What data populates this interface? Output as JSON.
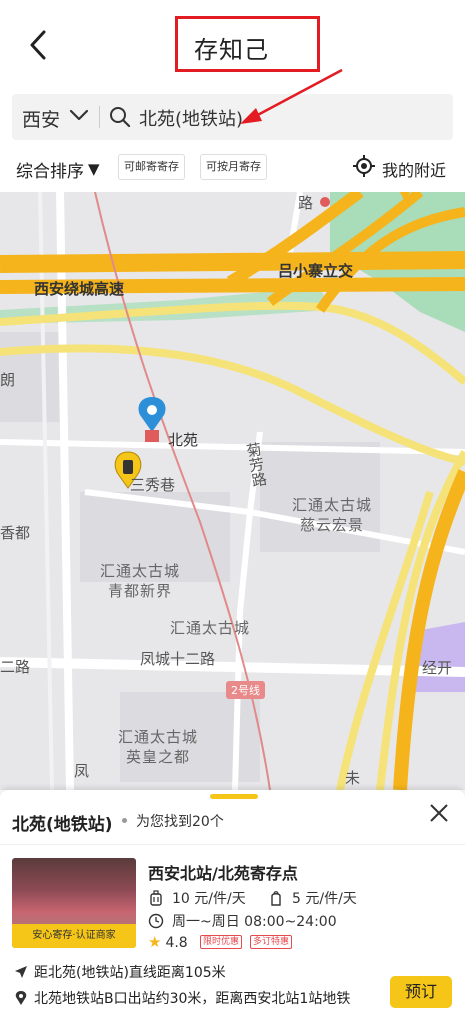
{
  "header": {
    "title": "存知己"
  },
  "search": {
    "city": "西安",
    "query": "北苑(地铁站)"
  },
  "filters": {
    "sort_label": "综合排序",
    "sort_arrow": "▼",
    "chip_mail": "可邮寄寄存",
    "chip_monthly": "可按月寄存",
    "nearby_label": "我的附近"
  },
  "map": {
    "labels": {
      "road_top": "路",
      "highway": "西安绕城高速",
      "interchange": "吕小寨立交",
      "left_fragment": "朗",
      "station": "北苑",
      "lane": "三秀巷",
      "juxiang_road": "菊芳路",
      "huitong_a_1": "汇通太古城",
      "huitong_a_2": "慈云宏景",
      "xiangdu_left": "香都",
      "huitong_b_1": "汇通太古城",
      "huitong_b_2": "青都新界",
      "huitong_c": "汇通太古城",
      "fengcheng": "凤城十二路",
      "er_road": "二路",
      "line2": "2号线",
      "huitong_d_1": "汇通太古城",
      "huitong_d_2": "英皇之都",
      "jingkai": "经开",
      "feng_bottom": "凤",
      "wei_bottom": "未"
    },
    "colors": {
      "background": "#e7e7ea",
      "expressway": "#f6b41c",
      "road_yellow": "#f5e37a",
      "green": "#a9dcb8",
      "purple": "#c8b8ef",
      "metro_line": "#e08a8a"
    }
  },
  "sheet": {
    "title": "北苑(地铁站)",
    "found": "为您找到20个",
    "store": {
      "name": "西安北站/北苑寄存点",
      "price_bag": "10 元/件/天",
      "price_small": "5 元/件/天",
      "hours": "周一~周日 08:00~24:00",
      "rating": "4.8",
      "tag_limited": "限时优惠",
      "tag_multi": "多订特惠",
      "thumb_caption": "安心寄存·认证商家"
    },
    "distance": "距北苑(地铁站)直线距离105米",
    "address": "北苑地铁站B口出站约30米，距离西安北站1站地铁",
    "book_label": "预订"
  }
}
